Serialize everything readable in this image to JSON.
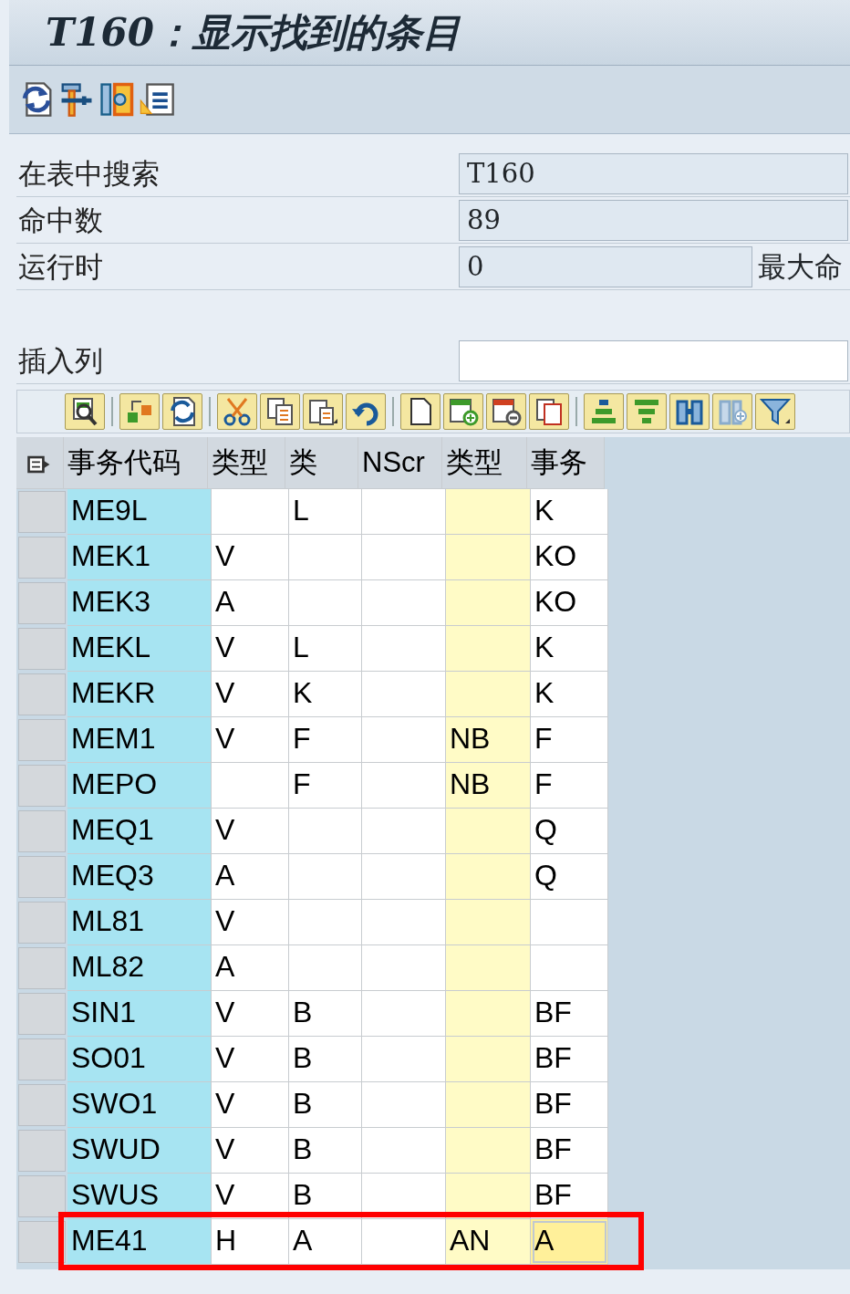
{
  "window": {
    "title": "T160：显示找到的条目"
  },
  "form": [
    {
      "label": "在表中搜索",
      "value": "T160"
    },
    {
      "label": "命中数",
      "value": "89"
    },
    {
      "label": "运行时",
      "value": "0",
      "trailing_label": "最大命"
    }
  ],
  "insert_column": {
    "label": "插入列"
  },
  "table": {
    "columns": [
      "事务代码",
      "类型",
      "类",
      "NScr",
      "类型",
      "事务"
    ],
    "rows": [
      {
        "cells": [
          "ME9L",
          "",
          "L",
          "",
          "",
          "K"
        ],
        "highlighted": false,
        "last_cell_focused": false
      },
      {
        "cells": [
          "MEK1",
          "V",
          "",
          "",
          "",
          "KO"
        ],
        "highlighted": false,
        "last_cell_focused": false
      },
      {
        "cells": [
          "MEK3",
          "A",
          "",
          "",
          "",
          "KO"
        ],
        "highlighted": false,
        "last_cell_focused": false
      },
      {
        "cells": [
          "MEKL",
          "V",
          "L",
          "",
          "",
          "K"
        ],
        "highlighted": false,
        "last_cell_focused": false
      },
      {
        "cells": [
          "MEKR",
          "V",
          "K",
          "",
          "",
          "K"
        ],
        "highlighted": false,
        "last_cell_focused": false
      },
      {
        "cells": [
          "MEM1",
          "V",
          "F",
          "",
          "NB",
          "F"
        ],
        "highlighted": false,
        "last_cell_focused": false
      },
      {
        "cells": [
          "MEPO",
          "",
          "F",
          "",
          "NB",
          "F"
        ],
        "highlighted": false,
        "last_cell_focused": false
      },
      {
        "cells": [
          "MEQ1",
          "V",
          "",
          "",
          "",
          "Q"
        ],
        "highlighted": false,
        "last_cell_focused": false
      },
      {
        "cells": [
          "MEQ3",
          "A",
          "",
          "",
          "",
          "Q"
        ],
        "highlighted": false,
        "last_cell_focused": false
      },
      {
        "cells": [
          "ML81",
          "V",
          "",
          "",
          "",
          ""
        ],
        "highlighted": false,
        "last_cell_focused": false
      },
      {
        "cells": [
          "ML82",
          "A",
          "",
          "",
          "",
          ""
        ],
        "highlighted": false,
        "last_cell_focused": false
      },
      {
        "cells": [
          "SIN1",
          "V",
          "B",
          "",
          "",
          "BF"
        ],
        "highlighted": false,
        "last_cell_focused": false
      },
      {
        "cells": [
          "SO01",
          "V",
          "B",
          "",
          "",
          "BF"
        ],
        "highlighted": false,
        "last_cell_focused": false
      },
      {
        "cells": [
          "SWO1",
          "V",
          "B",
          "",
          "",
          "BF"
        ],
        "highlighted": false,
        "last_cell_focused": false
      },
      {
        "cells": [
          "SWUD",
          "V",
          "B",
          "",
          "",
          "BF"
        ],
        "highlighted": false,
        "last_cell_focused": false
      },
      {
        "cells": [
          "SWUS",
          "V",
          "B",
          "",
          "",
          "BF"
        ],
        "highlighted": false,
        "last_cell_focused": false
      },
      {
        "cells": [
          "ME41",
          "H",
          "A",
          "",
          "AN",
          "A"
        ],
        "highlighted": true,
        "last_cell_focused": true
      }
    ]
  }
}
